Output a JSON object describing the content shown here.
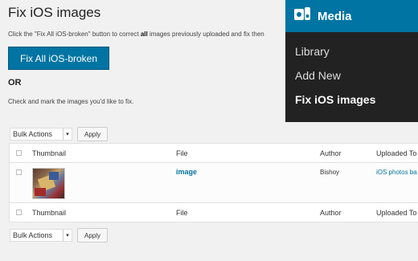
{
  "page": {
    "title": "Fix iOS images",
    "desc_before": "Click the \"Fix All iOS-broken\" button to correct ",
    "desc_bold": "all",
    "desc_after": " images previously uploaded and fix then",
    "fix_all_label": "Fix All iOS-broken",
    "or_label": "OR",
    "hint": "Check and mark the images you'd like to fix."
  },
  "bulk_top": {
    "selected": "Bulk Actions",
    "apply_label": "Apply"
  },
  "bulk_bottom": {
    "selected": "Bulk Actions",
    "apply_label": "Apply"
  },
  "table": {
    "columns": [
      "Thumbnail",
      "File",
      "Author",
      "Uploaded To"
    ],
    "rows": [
      {
        "file": "image",
        "author": "Bishoy",
        "uploaded_to": "iOS photos ba"
      }
    ]
  },
  "media_menu": {
    "title": "Media",
    "items": [
      "Library",
      "Add New",
      "Fix iOS images"
    ],
    "current_index": 2,
    "accent": "#0074a2",
    "background": "#222222"
  },
  "colors": {
    "primary": "#0074a2",
    "link": "#0074a2",
    "page_bg": "#f1f1f1"
  }
}
